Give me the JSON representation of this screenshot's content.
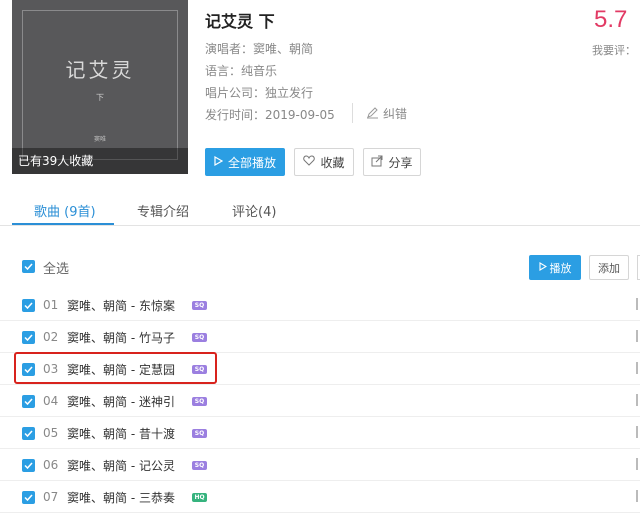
{
  "album": {
    "cover_title": "记艾灵",
    "cover_sub": "下",
    "cover_mark": "窦唯",
    "collect_caption": "已有39人收藏",
    "title": "记艾灵 下",
    "singer_label": "演唱者：",
    "singer_value": "窦唯、朝简",
    "language_label": "语言：",
    "language_value": "纯音乐",
    "company_label": "唱片公司：",
    "company_value": "独立发行",
    "date_label": "发行时间：",
    "date_value": "2019-09-05",
    "correct_label": "纠错",
    "score": "5.7",
    "rate_label": "我要评："
  },
  "actions": {
    "play_all": "全部播放",
    "favorite": "收藏",
    "share": "分享"
  },
  "tabs": [
    {
      "label": "歌曲 (9首)"
    },
    {
      "label": "专辑介绍"
    },
    {
      "label": "评论(4)"
    }
  ],
  "list_toolbar": {
    "select_all": "全选",
    "play": "播放",
    "add": "添加"
  },
  "songs": [
    {
      "num": "01",
      "name": "窦唯、朝简 - 东惊案",
      "badge": "SQ"
    },
    {
      "num": "02",
      "name": "窦唯、朝简 - 竹马子",
      "badge": "SQ"
    },
    {
      "num": "03",
      "name": "窦唯、朝简 - 定慧园",
      "badge": "SQ"
    },
    {
      "num": "04",
      "name": "窦唯、朝简 - 迷神引",
      "badge": "SQ"
    },
    {
      "num": "05",
      "name": "窦唯、朝简 - 昔十渡",
      "badge": "SQ"
    },
    {
      "num": "06",
      "name": "窦唯、朝简 - 记公灵",
      "badge": "SQ"
    },
    {
      "num": "07",
      "name": "窦唯、朝简 - 三恭奏",
      "badge": "HQ"
    }
  ],
  "colors": {
    "accent": "#2b9ee3",
    "score": "#e23a64",
    "sq_badge": "#9b7fe0",
    "hq_badge": "#36b37e",
    "highlight": "#d8231d"
  }
}
